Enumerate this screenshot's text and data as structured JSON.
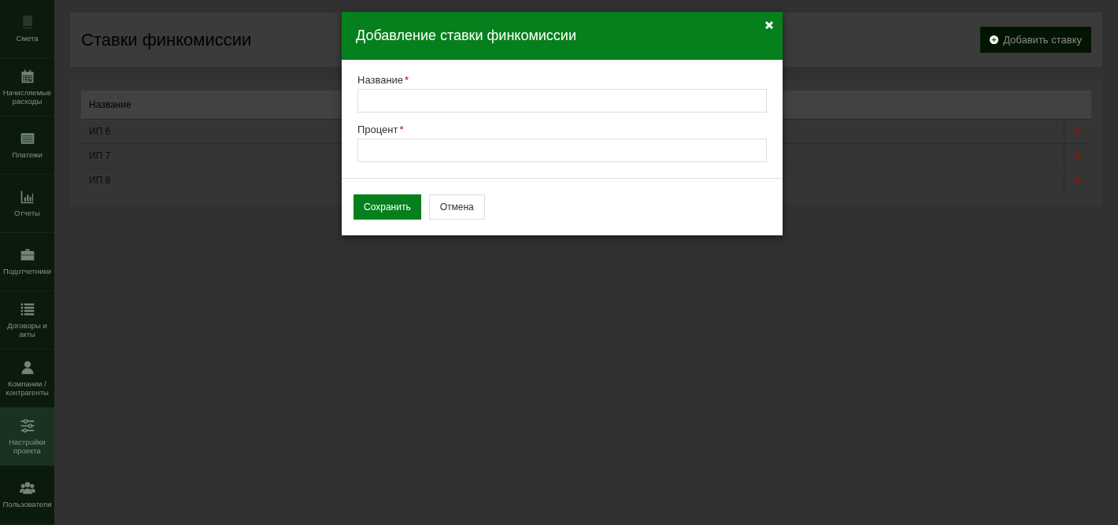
{
  "sidebar": {
    "items": [
      {
        "label": "Смета",
        "selected": false
      },
      {
        "label": "Начисляемые расходы",
        "selected": false
      },
      {
        "label": "Платежи",
        "selected": false
      },
      {
        "label": "Отчеты",
        "selected": false
      },
      {
        "label": "Подотчетники",
        "selected": false
      },
      {
        "label": "Договоры и акты",
        "selected": false
      },
      {
        "label": "Компании / контрагенты",
        "selected": false
      },
      {
        "label": "Настройки проекта",
        "selected": true
      },
      {
        "label": "Пользователи",
        "selected": false
      }
    ]
  },
  "page": {
    "title": "Ставки финкомиссии",
    "add_button": "Добавить ставку"
  },
  "table": {
    "columns": [
      "Название"
    ],
    "rows": [
      {
        "name": "ИП 6"
      },
      {
        "name": "ИП 7"
      },
      {
        "name": "ИП 8"
      }
    ]
  },
  "modal": {
    "title": "Добавление ставки финкомиссии",
    "fields": [
      {
        "label": "Название",
        "required_mark": "*"
      },
      {
        "label": "Процент",
        "required_mark": "*"
      }
    ],
    "save_button": "Сохранить",
    "cancel_button": "Отмена"
  }
}
